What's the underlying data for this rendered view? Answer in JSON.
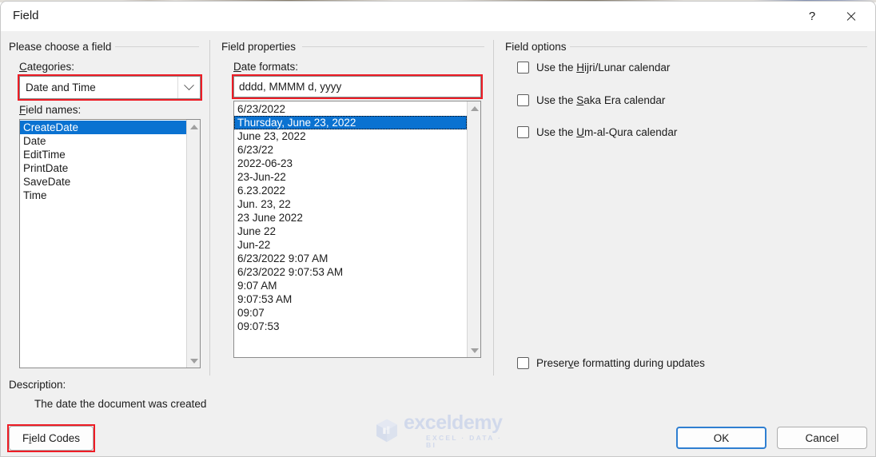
{
  "window": {
    "title": "Field",
    "help_label": "?",
    "close_label": "close-icon"
  },
  "left_panel": {
    "group_title": "Please choose a field",
    "categories_label": "Categories:",
    "categories_value": "Date and Time",
    "field_names_label": "Field names:",
    "field_names": [
      "CreateDate",
      "Date",
      "EditTime",
      "PrintDate",
      "SaveDate",
      "Time"
    ],
    "field_names_selected_index": 0
  },
  "middle_panel": {
    "group_title": "Field properties",
    "date_formats_label": "Date formats:",
    "date_format_value": "dddd, MMMM d, yyyy",
    "date_formats": [
      "6/23/2022",
      "Thursday, June 23, 2022",
      "June 23, 2022",
      "6/23/22",
      "2022-06-23",
      "23-Jun-22",
      "6.23.2022",
      "Jun. 23, 22",
      "23 June 2022",
      "June 22",
      "Jun-22",
      "6/23/2022 9:07 AM",
      "6/23/2022 9:07:53 AM",
      "9:07 AM",
      "9:07:53 AM",
      "09:07",
      "09:07:53"
    ],
    "date_formats_selected_index": 1
  },
  "right_panel": {
    "group_title": "Field options",
    "options": [
      {
        "pre": "Use the ",
        "accel": "H",
        "post": "ijri/Lunar calendar",
        "checked": false
      },
      {
        "pre": "Use the ",
        "accel": "S",
        "post": "aka Era calendar",
        "checked": false
      },
      {
        "pre": "Use the ",
        "accel": "U",
        "post": "m-al-Qura calendar",
        "checked": false
      }
    ],
    "preserve": {
      "pre": "Preser",
      "accel": "v",
      "post": "e formatting during updates",
      "checked": false
    }
  },
  "footer": {
    "description_label": "Description:",
    "description_text": "The date the document was created",
    "field_codes": {
      "pre": "F",
      "accel": "i",
      "post": "eld Codes"
    },
    "ok_label": "OK",
    "cancel_label": "Cancel"
  },
  "watermark": {
    "word": "exceldemy",
    "tagline": "EXCEL · DATA · BI"
  },
  "colors": {
    "dialog_bg": "#f0f0f0",
    "titlebar_bg": "#ffffff",
    "selection_blue": "#0a72d1",
    "annotation_red": "#ee1c25",
    "default_button_border": "#2f7fd1"
  }
}
